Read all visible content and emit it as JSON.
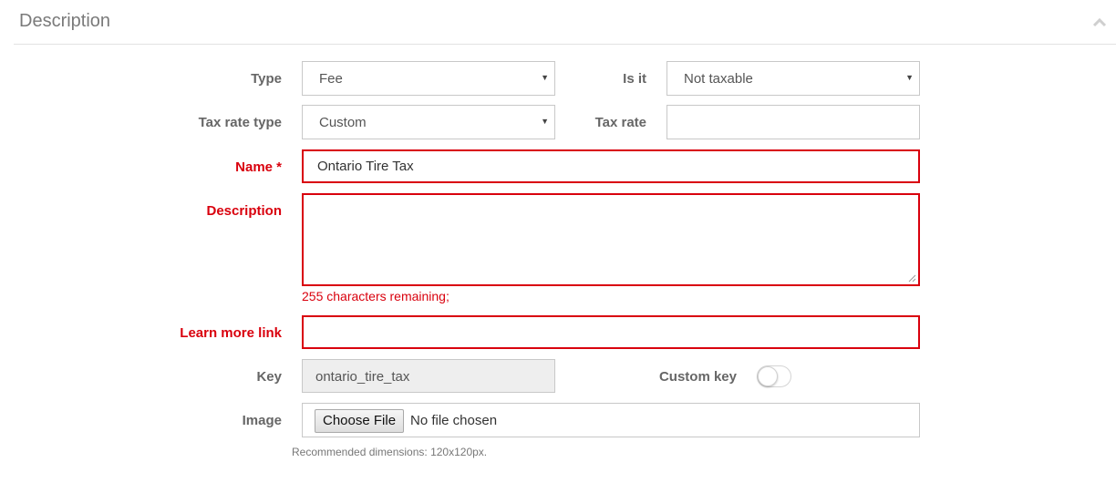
{
  "panel": {
    "title": "Description"
  },
  "form": {
    "type": {
      "label": "Type",
      "value": "Fee"
    },
    "is_it": {
      "label": "Is it",
      "value": "Not taxable"
    },
    "tax_rate_type": {
      "label": "Tax rate type",
      "value": "Custom"
    },
    "tax_rate": {
      "label": "Tax rate",
      "value": ""
    },
    "name": {
      "label": "Name *",
      "value": "Ontario Tire Tax"
    },
    "description": {
      "label": "Description",
      "value": "",
      "help": "255 characters remaining;"
    },
    "learn_more": {
      "label": "Learn more link",
      "value": ""
    },
    "key": {
      "label": "Key",
      "value": "ontario_tire_tax"
    },
    "custom_key": {
      "label": "Custom key",
      "enabled": false
    },
    "image": {
      "label": "Image",
      "button": "Choose File",
      "status": "No file chosen",
      "help": "Recommended dimensions: 120x120px."
    }
  },
  "colors": {
    "error": "#d9000d",
    "label": "#666666",
    "border": "#c8c8c8",
    "readonly_bg": "#eeeeee"
  },
  "icons": [
    "chevron-up-icon",
    "caret-down-icon",
    "resize-grip-icon"
  ]
}
